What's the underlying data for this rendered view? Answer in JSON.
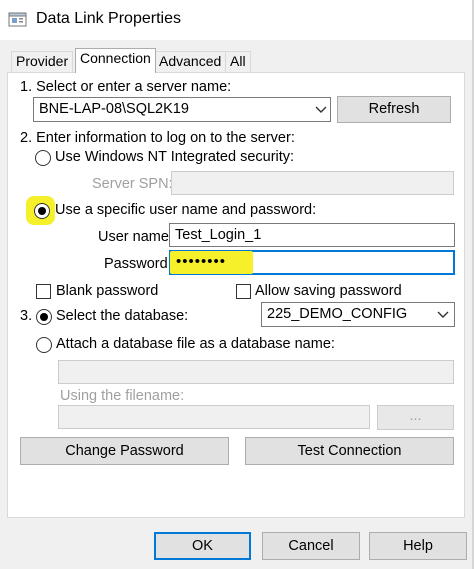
{
  "window": {
    "title": "Data Link Properties"
  },
  "tabs": [
    {
      "label": "Provider",
      "active": false
    },
    {
      "label": "Connection",
      "active": true
    },
    {
      "label": "Advanced",
      "active": false
    },
    {
      "label": "All",
      "active": false
    }
  ],
  "connection": {
    "step1_label": "1. Select or enter a server name:",
    "server_value": "BNE-LAP-08\\SQL2K19",
    "refresh_label": "Refresh",
    "step2_label": "2. Enter information to log on to the server:",
    "use_windows_label": "Use Windows NT Integrated security:",
    "server_spn_label": "Server SPN:",
    "server_spn_value": "",
    "use_specific_label": "Use a specific user name and password:",
    "username_label": "User name:",
    "username_value": "Test_Login_1",
    "password_label": "Password:",
    "password_value": "••••••••",
    "blank_password_label": "Blank password",
    "allow_saving_label": "Allow saving password",
    "step3_number": "3.",
    "select_database_label": "Select the database:",
    "database_value": "225_DEMO_CONFIG",
    "attach_label": "Attach a database file as a database name:",
    "attach_value": "",
    "using_filename_label": "Using the filename:",
    "filename_value": "",
    "browse_label": "...",
    "change_password_label": "Change Password",
    "test_connection_label": "Test Connection"
  },
  "footer": {
    "ok_label": "OK",
    "cancel_label": "Cancel",
    "help_label": "Help"
  },
  "colors": {
    "highlight": "#f5f02a",
    "focus_border": "#0078d7",
    "dialog_bg": "#f0f0f0"
  },
  "icons": {
    "window": "data-link-icon",
    "combo": "chevron-down-icon"
  }
}
